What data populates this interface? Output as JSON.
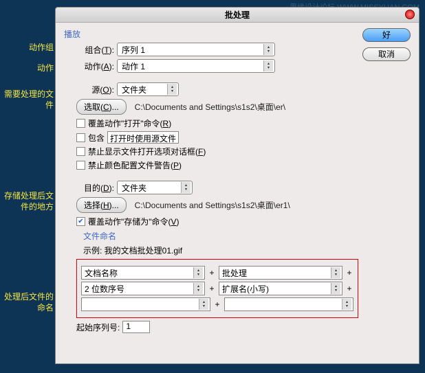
{
  "watermark": "思缘设计论坛  WWW.MISSYUAN.COM",
  "annotations": {
    "set": "动作组",
    "action": "动作",
    "source": "需要处理的文件",
    "dest": "存储处理后文件的地方",
    "naming": "处理后文件的命名"
  },
  "dialog": {
    "title": "批处理",
    "ok": "好",
    "cancel": "取消"
  },
  "play": {
    "section": "播放",
    "set_label_pre": "组合(",
    "set_key": "T",
    "set_label_post": "):",
    "set_value": "序列 1",
    "action_label_pre": "动作(",
    "action_key": "A",
    "action_label_post": "):",
    "action_value": "动作 1"
  },
  "source": {
    "label_pre": "源(",
    "key": "O",
    "label_post": "):",
    "value": "文件夹",
    "choose_pre": "选取(",
    "choose_key": "C",
    "choose_post": ")...",
    "path": "C:\\Documents and Settings\\s1s2\\桌面\\er\\",
    "cb1_pre": "覆盖动作\"打开\"命令(",
    "cb1_key": "R",
    "cb1_post": ")",
    "cb2_pre": "包含",
    "cb2_hint": "打开时使用源文件",
    "cb3_pre": "禁止显示文件打开选项对话框(",
    "cb3_key": "F",
    "cb3_post": ")",
    "cb4_pre": "禁止颜色配置文件警告(",
    "cb4_key": "P",
    "cb4_post": ")"
  },
  "dest": {
    "label_pre": "目的(",
    "key": "D",
    "label_post": "):",
    "value": "文件夹",
    "choose_pre": "选择(",
    "choose_key": "H",
    "choose_post": ")...",
    "path": "C:\\Documents and Settings\\s1s2\\桌面\\er1\\",
    "cb_pre": "覆盖动作\"存储为\"命令(",
    "cb_key": "V",
    "cb_post": ")",
    "cb_checked": "✔"
  },
  "naming": {
    "section": "文件命名",
    "example_label": "示例: ",
    "example_value": "我的文档批处理01.gif",
    "fields": {
      "f1": "文档名称",
      "f2": "批处理",
      "f3": "2 位数序号",
      "f4": "扩展名(小写)",
      "f5": "",
      "f6": ""
    },
    "plus": "+",
    "start_label": "起始序列号:",
    "start_value": "1"
  }
}
